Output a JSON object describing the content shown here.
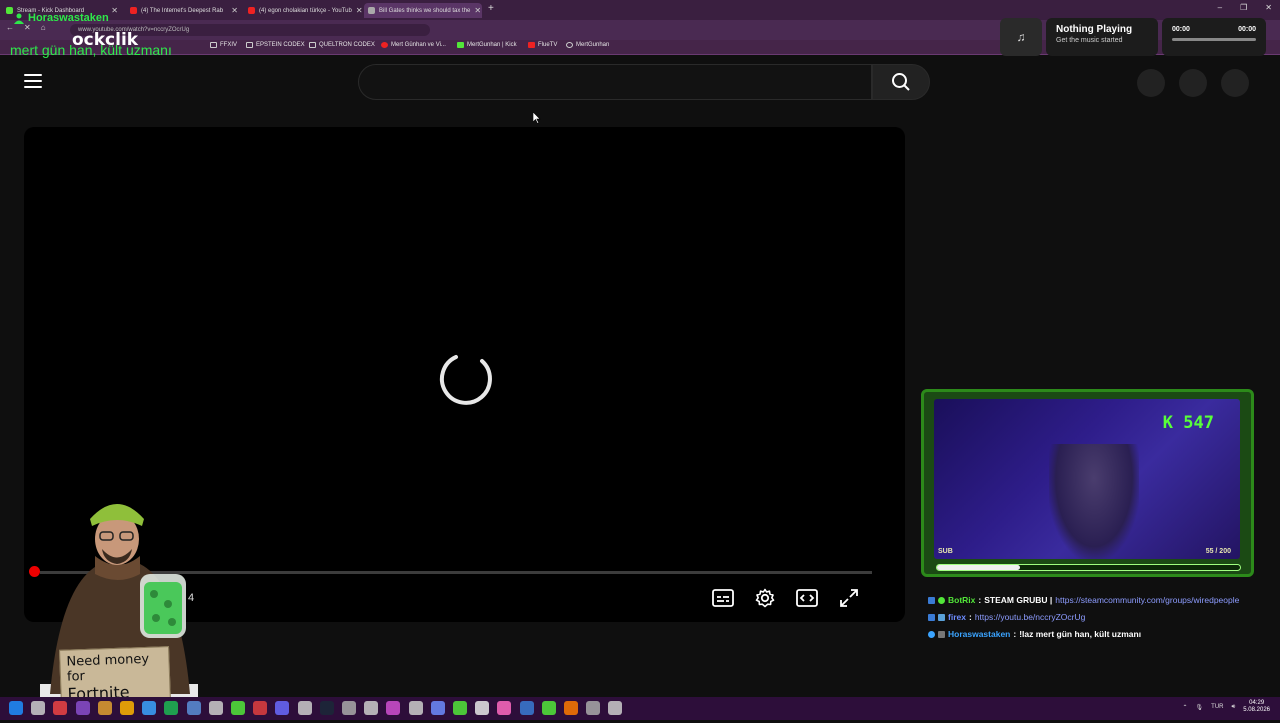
{
  "browser": {
    "tabs": [
      {
        "label": "Stream - Kick Dashboard",
        "active": false
      },
      {
        "label": "(4) The Internet's Deepest Rab",
        "active": false
      },
      {
        "label": "(4) egon cholakian türkçe - YouTub",
        "active": false
      },
      {
        "label": "Bill Gates thinks we should tax the",
        "active": true
      }
    ],
    "url": "www.youtube.com/watch?v=nccryZOcrUg",
    "bookmarks": [
      "FFXIV",
      "EPSTEIN CODEX",
      "QUELTRON CODEX",
      "Mert Günhan ve Vi...",
      "MertGunhan | Kick",
      "FlueTV",
      "MertGunhan"
    ]
  },
  "overlay": {
    "streamer_name": "Horaswastaken",
    "kick_logo": "ockclik",
    "chat_highlight": "mert gün han, kült uzmanı"
  },
  "music": {
    "title": "Nothing Playing",
    "subtitle": "Get the music started",
    "time_start": "00:00",
    "time_end": "00:00"
  },
  "player": {
    "loading": true,
    "time_fragment": "4"
  },
  "webcam": {
    "kick_count": "547",
    "sub_label": "SUB",
    "sub_progress_text": "55 / 200",
    "sub_progress": 0.275
  },
  "chat": [
    {
      "user": "BotRix",
      "user_color": "#52e639",
      "message": "STEAM GRUBU |",
      "link": "https://steamcommunity.com/groups/wiredpeople"
    },
    {
      "user": "firex",
      "user_color": "#6d8cff",
      "message": "",
      "link": "https://youtu.be/nccryZOcrUg"
    },
    {
      "user": "Horaswastaken",
      "user_color": "#3ba4ff",
      "message": "!laz mert gün han, kült uzmanı",
      "link": ""
    }
  ],
  "sign": {
    "line1": "Need money for",
    "line2": "Fortnite skins"
  },
  "taskbar": {
    "language": "TUR",
    "time": "04:29",
    "date": "5.08.2026"
  },
  "colors": {
    "kick_green": "#52e639",
    "youtube_red": "#ff0000",
    "browser_purple": "#3a1f40"
  }
}
